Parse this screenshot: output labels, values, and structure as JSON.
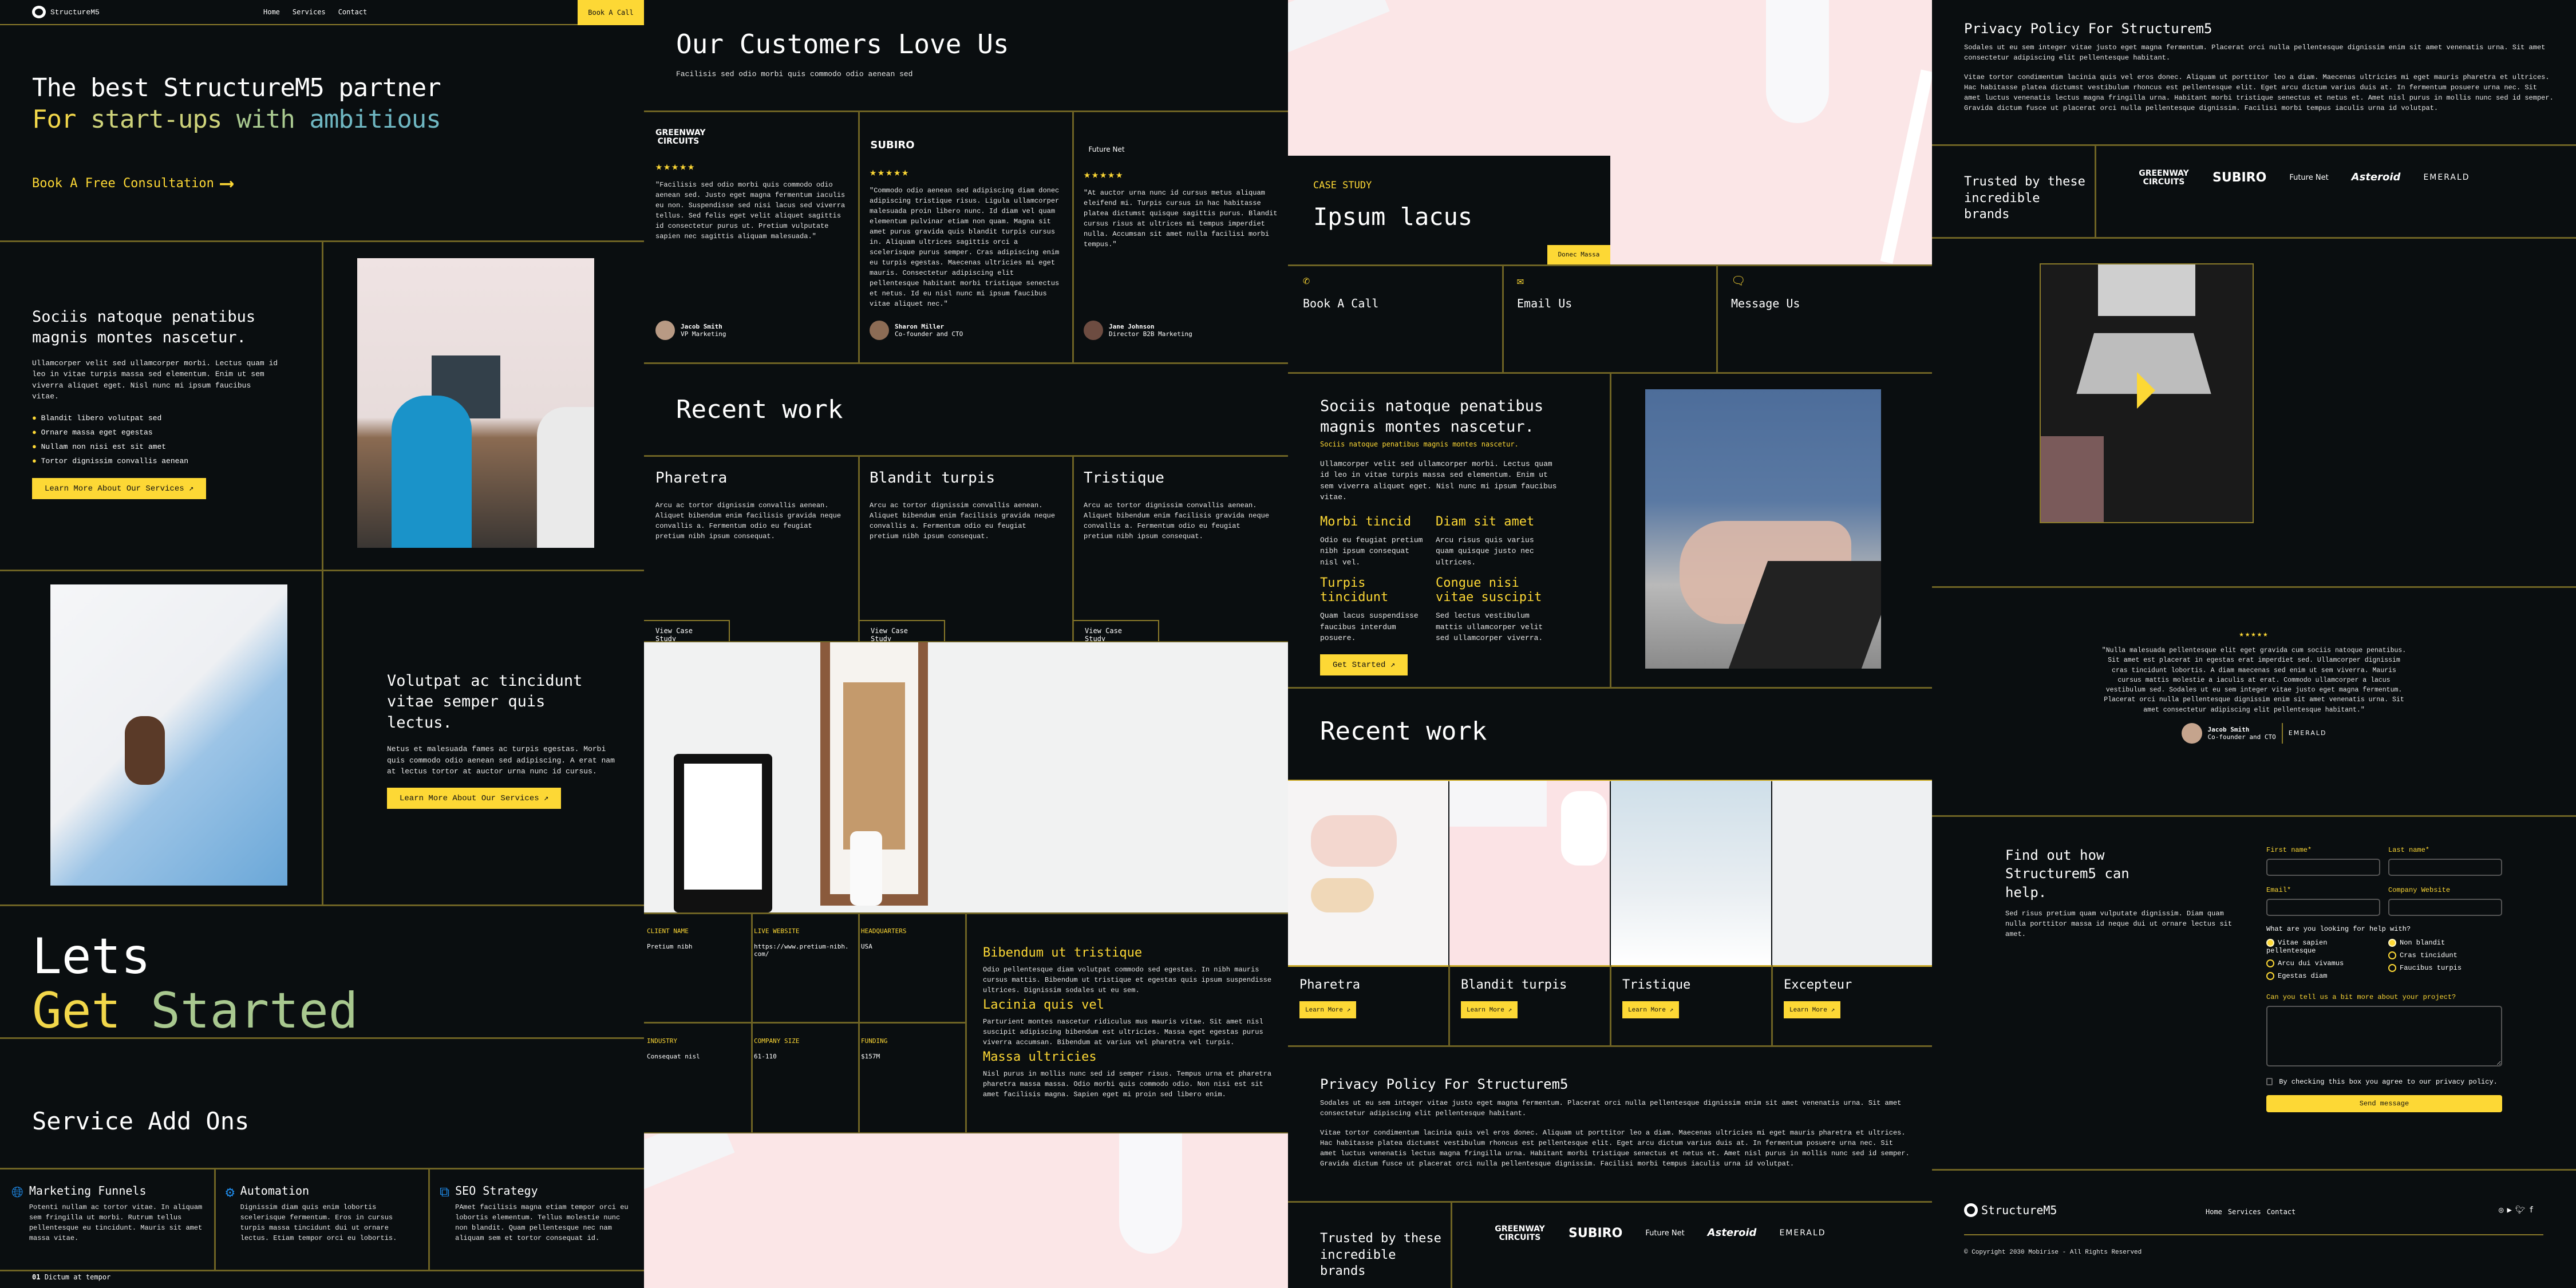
{
  "brand": {
    "name": "StructureM5",
    "accent": "#fdd835",
    "background": "#0a0e10"
  },
  "nav": {
    "items": [
      "Home",
      "Services",
      "Contact"
    ],
    "cta": "Book A Call"
  },
  "hero": {
    "line1": "The best StructureM5 partner",
    "line2_words": [
      "For",
      "start-ups",
      "with",
      "ambitious"
    ],
    "link": "Book A Free Consultation"
  },
  "feature1": {
    "title": "Sociis natoque penatibus magnis montes nascetur.",
    "body": "Ullamcorper velit sed ullamcorper morbi. Lectus quam id leo in vitae turpis massa sed elementum. Enim ut sem viverra aliquet eget. Nisl nunc mi ipsum faucibus vitae.",
    "checks": [
      "Blandit libero volutpat sed",
      "Ornare massa eget egestas",
      "Nullam non nisi est sit amet",
      "Tortor dignissim convallis aenean"
    ],
    "button": "Learn More About Our Services ↗"
  },
  "feature2": {
    "title": "Volutpat ac tincidunt vitae semper quis lectus.",
    "body": "Netus et malesuada fames ac turpis egestas. Morbi quis commodo odio aenean sed adipiscing. A erat nam at lectus tortor at auctor urna nunc id cursus.",
    "button": "Learn More About Our Services ↗"
  },
  "lets": {
    "line1": "Lets",
    "line2_words": [
      "Get",
      "Started"
    ]
  },
  "addons": {
    "title": "Service Add Ons",
    "items": [
      {
        "icon": "globe-icon",
        "title": "Marketing Funnels",
        "body": "Potenti nullam ac tortor vitae. In aliquam sem fringilla ut morbi. Rutrum tellus pellentesque eu tincidunt. Mauris sit amet massa vitae."
      },
      {
        "icon": "gear-icon",
        "title": "Automation",
        "body": "Dignissim diam quis enim lobortis scelerisque fermentum. Eros in cursus turpis massa tincidunt dui ut ornare lectus. Etiam tempor orci eu lobortis."
      },
      {
        "icon": "apps-star-icon",
        "title": "SEO Strategy",
        "body": "PAmet facilisis magna etiam tempor orci eu lobortis elementum. Tellus molestie nunc non blandit. Quam pellentesque nec nam aliquam sem et tortor consequat id."
      }
    ],
    "footer_num": "01",
    "footer_text": "Dictum at tempor"
  },
  "testimonials": {
    "title": "Our Customers Love Us",
    "subtitle": "Facilisis sed odio morbi quis commodo odio aenean sed",
    "rating": 5,
    "items": [
      {
        "logo": "GREENWAY CIRCUITS",
        "quote": "\"Facilisis sed odio morbi quis commodo odio aenean sed. Justo eget magna fermentum iaculis eu non. Suspendisse sed nisi lacus sed viverra tellus. Sed felis eget velit aliquet sagittis id consectetur purus ut. Pretium vulputate sapien nec sagittis aliquam malesuada.\"",
        "name": "Jacob Smith",
        "role": "VP Marketing"
      },
      {
        "logo": "SUBIRO",
        "quote": "\"Commodo odio aenean sed adipiscing diam donec adipiscing tristique risus. Ligula ullamcorper malesuada proin libero nunc. Id diam vel quam elementum pulvinar etiam non quam. Magna sit amet purus gravida quis blandit turpis cursus in. Aliquam ultrices sagittis orci a scelerisque purus semper. Cras adipiscing enim eu turpis egestas. Maecenas ultricies mi eget mauris. Consectetur adipiscing elit pellentesque habitant morbi tristique senectus et netus. Id eu nisl nunc mi ipsum faucibus vitae aliquet nec.\"",
        "name": "Sharon Miller",
        "role": "Co-founder and CTO"
      },
      {
        "logo": "Future Net",
        "quote": "\"At auctor urna nunc id cursus metus aliquam eleifend mi. Turpis cursus in hac habitasse platea dictumst quisque sagittis purus. Blandit cursus risus at ultrices mi tempus imperdiet nulla. Accumsan sit amet nulla facilisi morbi tempus.\"",
        "name": "Jane Johnson",
        "role": "Director B2B Marketing"
      }
    ]
  },
  "recent1": {
    "title": "Recent work",
    "items": [
      {
        "title": "Pharetra",
        "body": "Arcu ac tortor dignissim convallis aenean. Aliquet bibendum enim facilisis gravida neque convallis a. Fermentum odio eu feugiat pretium nibh ipsum consequat.",
        "link": "View Case Study"
      },
      {
        "title": "Blandit turpis",
        "body": "Arcu ac tortor dignissim convallis aenean. Aliquet bibendum enim facilisis gravida neque convallis a. Fermentum odio eu feugiat pretium nibh ipsum consequat.",
        "link": "View Case Study"
      },
      {
        "title": "Tristique",
        "body": "Arcu ac tortor dignissim convallis aenean. Aliquet bibendum enim facilisis gravida neque convallis a. Fermentum odio eu feugiat pretium nibh ipsum consequat.",
        "link": "View Case Study"
      }
    ]
  },
  "client": {
    "facts": [
      {
        "label": "CLIENT NAME",
        "value": "Pretium nibh"
      },
      {
        "label": "LIVE WEBSITE",
        "value": "https://www.pretium-nibh.com/"
      },
      {
        "label": "HEADQUARTERS",
        "value": "USA"
      },
      {
        "label": "INDUSTRY",
        "value": "Consequat nisl"
      },
      {
        "label": "COMPANY SIZE",
        "value": "61-110"
      },
      {
        "label": "FUNDING",
        "value": "$157M"
      }
    ],
    "sections": [
      {
        "title": "Bibendum ut tristique",
        "body": "Odio pellentesque diam volutpat commodo sed egestas. In nibh mauris cursus mattis. Bibendum ut tristique et egestas quis ipsum suspendisse ultrices. Dignissim sodales ut eu sem."
      },
      {
        "title": "Lacinia quis vel",
        "body": "Parturient montes nascetur ridiculus mus mauris vitae. Sit amet nisl suscipit adipiscing bibendum est ultricies. Massa eget egestas purus viverra accumsan. Bibendum at varius vel pharetra vel turpis."
      },
      {
        "title": "Massa ultricies",
        "body": "Nisl purus in mollis nunc sed id semper risus. Tempus urna et pharetra pharetra massa massa. Odio morbi quis commodo odio. Non nisi est sit amet facilisis magna. Sapien eget mi proin sed libero enim."
      }
    ]
  },
  "case": {
    "eyebrow": "CASE STUDY",
    "title": "Ipsum lacus",
    "tag": "Donec Massa"
  },
  "contact_cards": [
    {
      "icon": "phone-icon",
      "label": "Book A Call"
    },
    {
      "icon": "mail-icon",
      "label": "Email Us"
    },
    {
      "icon": "chat-icon",
      "label": "Message Us"
    }
  ],
  "feature3": {
    "title": "Sociis natoque penatibus magnis montes nascetur.",
    "subtitle": "Sociis natoque penatibus magnis montes nascetur.",
    "body": "Ullamcorper velit sed ullamcorper morbi. Lectus quam id leo in vitae turpis massa sed elementum. Enim ut sem viverra aliquet eget. Nisl nunc mi ipsum faucibus vitae.",
    "grid": [
      {
        "title": "Morbi tincid",
        "body": "Odio eu feugiat pretium nibh ipsum consequat nisl vel."
      },
      {
        "title": "Diam sit amet",
        "body": "Arcu risus quis varius quam quisque justo nec ultrices."
      },
      {
        "title": "Turpis tincidunt",
        "body": "Quam lacus suspendisse faucibus interdum posuere."
      },
      {
        "title": "Congue nisi vitae suscipit",
        "body": "Sed lectus vestibulum mattis ullamcorper velit sed ullamcorper viverra."
      }
    ],
    "button": "Get Started ↗"
  },
  "recent2": {
    "title": "Recent work",
    "items": [
      {
        "title": "Pharetra",
        "button": "Learn More ↗"
      },
      {
        "title": "Blandit turpis",
        "button": "Learn More ↗"
      },
      {
        "title": "Tristique",
        "button": "Learn More ↗"
      },
      {
        "title": "Excepteur",
        "button": "Learn More ↗"
      }
    ]
  },
  "privacy": {
    "title": "Privacy Policy For Structurem5",
    "p1": "Sodales ut eu sem integer vitae justo eget magna fermentum. Placerat orci nulla pellentesque dignissim enim sit amet venenatis urna. Sit amet consectetur adipiscing elit pellentesque habitant.",
    "p2": "Vitae tortor condimentum lacinia quis vel eros donec. Aliquam ut porttitor leo a diam. Maecenas ultricies mi eget mauris pharetra et ultrices. Hac habitasse platea dictumst vestibulum rhoncus est pellentesque elit. Eget arcu dictum varius duis at. In fermentum posuere urna nec. Sit amet luctus venenatis lectus magna fringilla urna. Habitant morbi tristique senectus et netus et. Amet nisl purus in mollis nunc sed id semper. Gravida dictum fusce ut placerat orci nulla pellentesque dignissim. Facilisi morbi tempus iaculis urna id volutpat."
  },
  "brands": {
    "title": "Trusted by these incredible brands",
    "logos": [
      "GREENWAY CIRCUITS",
      "SUBIRO",
      "Future Net",
      "Asteroid",
      "EMERALD"
    ]
  },
  "single_testimonial": {
    "rating": 5,
    "quote": "\"Nulla malesuada pellentesque elit eget gravida cum sociis natoque penatibus. Sit amet est placerat in egestas erat imperdiet sed. Ullamcorper dignissim cras tincidunt lobortis. A diam maecenas sed enim ut sem viverra. Mauris cursus mattis molestie a iaculis at erat. Commodo ullamcorper a lacus vestibulum sed. Sodales ut eu sem integer vitae justo eget magna fermentum. Placerat orci nulla pellentesque dignissim enim sit amet venenatis urna. Sit amet consectetur adipiscing elit pellentesque habitant.\"",
    "name": "Jacob Smith",
    "role": "Co-founder and CTO",
    "logo": "EMERALD"
  },
  "form": {
    "title": "Find out how Structurem5 can help.",
    "body": "Sed risus pretium quam vulputate dignissim. Diam quam nulla porttitor massa id neque dui ut ornare lectus sit amet.",
    "fields": [
      {
        "label": "First name*",
        "value": "",
        "placeholder": ""
      },
      {
        "label": "Last name*",
        "value": "",
        "placeholder": ""
      },
      {
        "label": "Email*",
        "value": "",
        "placeholder": ""
      },
      {
        "label": "Company Website",
        "value": "",
        "placeholder": ""
      }
    ],
    "question": "What are you looking for help with?",
    "options_left": [
      {
        "label": "Vitae sapien pellentesque",
        "checked": true
      },
      {
        "label": "Arcu dui vivamus",
        "checked": false
      },
      {
        "label": "Egestas diam",
        "checked": false
      }
    ],
    "options_right": [
      {
        "label": "Non blandit",
        "checked": true
      },
      {
        "label": "Cras tincidunt",
        "checked": false
      },
      {
        "label": "Faucibus turpis",
        "checked": false
      }
    ],
    "project_label": "Can you tell us a bit more about your project?",
    "project_value": "",
    "consent": "By checking this box you agree to our privacy policy.",
    "consent_checked": false,
    "submit": "Send message"
  },
  "footer": {
    "brand": "StructureM5",
    "nav": [
      "Home",
      "Services",
      "Contact"
    ],
    "social": [
      "instagram-icon",
      "youtube-icon",
      "twitter-icon",
      "facebook-icon"
    ],
    "copyright": "© Copyright 2030 Mobirise - All Rights Reserved"
  }
}
